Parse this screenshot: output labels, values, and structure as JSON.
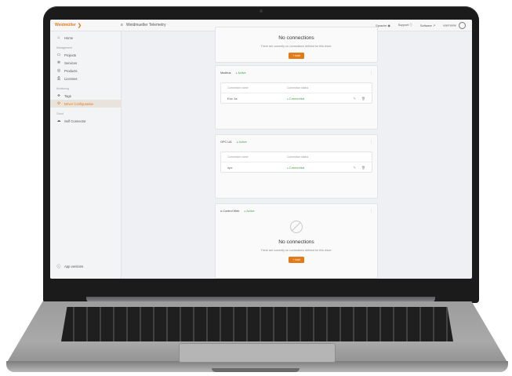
{
  "app": {
    "brand": "Weidmüller",
    "title": "Weidmueller Telemetry",
    "menu_icon": "hamburger-icon"
  },
  "topbar": {
    "language": "Sprache",
    "support": "Support",
    "software": "Software",
    "user": "username"
  },
  "sidebar": {
    "home": "Home",
    "management_section": "Management",
    "projects": "Projects",
    "services": "Services",
    "products": "Products",
    "licenses": "Licenses",
    "monitoring_section": "Monitoring",
    "tags": "Tags",
    "driver_config": "Driver Configuration",
    "cloud_section": "Cloud",
    "self_connector": "Self Connector",
    "app_versions": "App versions"
  },
  "cards": {
    "top": {
      "title": "No connections",
      "text": "There are currently no connections defined for this driver.",
      "add": "Add"
    },
    "modbus": {
      "name": "Modbus",
      "status": "Active",
      "col_name": "Connection name",
      "col_status": "Connection status",
      "row_name": "Enc 1a",
      "row_status": "Connected"
    },
    "opcua": {
      "name": "OPC UA",
      "status": "Active",
      "col_name": "Connection name",
      "col_status": "Connection status",
      "row_name": "opc",
      "row_status": "Connected"
    },
    "uremote": {
      "name": "u-Control Web",
      "status": "Active",
      "title": "No connections",
      "text": "There are currently no connections defined for this driver.",
      "add": "Add"
    }
  },
  "colors": {
    "accent": "#e47a16",
    "success": "#3ea845",
    "laptop": "#1b1b1c"
  }
}
